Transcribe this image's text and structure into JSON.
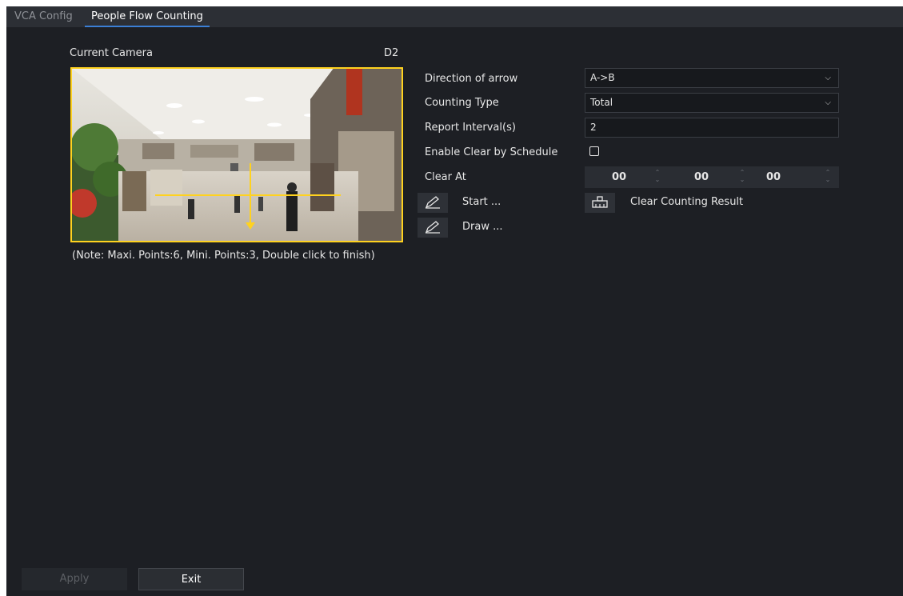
{
  "tabs": [
    {
      "label": "VCA Config",
      "active": false
    },
    {
      "label": "People Flow Counting",
      "active": true
    }
  ],
  "camera": {
    "label": "Current Camera",
    "channel": "D2",
    "note": "(Note: Maxi. Points:6, Mini. Points:3, Double click to finish)"
  },
  "form": {
    "direction_label": "Direction of arrow",
    "direction_value": "A->B",
    "counting_type_label": "Counting Type",
    "counting_type_value": "Total",
    "report_interval_label": "Report Interval(s)",
    "report_interval_value": "2",
    "enable_clear_label": "Enable Clear by Schedule",
    "enable_clear_checked": false,
    "clear_at_label": "Clear At",
    "clear_at": {
      "hour": "00",
      "minute": "00",
      "second": "00"
    }
  },
  "actions": {
    "start_label": "Start ...",
    "draw_label": "Draw ...",
    "clear_result_label": "Clear Counting Result"
  },
  "footer": {
    "apply_label": "Apply",
    "exit_label": "Exit"
  },
  "colors": {
    "background": "#1d1f24",
    "tabbar": "#2c2f35",
    "active_tab_underline": "#3b7fd6",
    "overlay_yellow": "#ffd21f"
  },
  "icons": {
    "pencil": "pencil-icon",
    "clear": "clear-counting-icon",
    "chevron": "chevron-down-icon"
  }
}
